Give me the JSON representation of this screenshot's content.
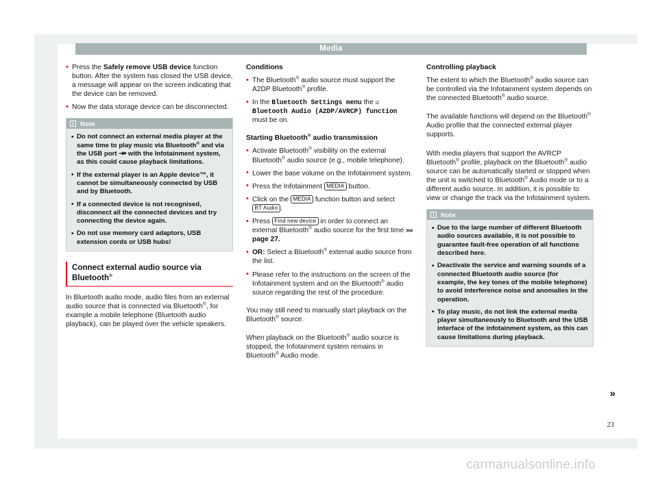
{
  "page": {
    "chapter_header": "Media",
    "page_number": "23",
    "continuation_marker": "»",
    "watermark": "carmanualsonline.info",
    "accent_red": "#e2001a",
    "header_bar_color": "#a8b4b4",
    "note_box_bg": "#e6eaea"
  },
  "left_column": {
    "bullets": [
      {
        "pre": "Press the ",
        "bold": "Safely remove USB device",
        "post": " function button. After the system has closed the USB device, a message will appear on the screen indicating that the device can be removed."
      },
      {
        "pre": "",
        "bold": "",
        "post": "Now the data storage device can be disconnected."
      }
    ],
    "note": {
      "title": "Note",
      "icon": "info-icon",
      "bullets": [
        {
          "part1": "Do not connect an external media player at the same time to play music via Bluetooth",
          "sup1": "®",
          "part2": " and via the USB port ",
          "usb_glyph": "⇥•",
          "part3": " with the Infotainment system, as this could cause playback limitations."
        },
        {
          "text": "If the external player is an Apple device™, it cannot be simultaneously connected by USB and by Bluetooth."
        },
        {
          "text": "If a connected device is not recognised, disconnect all the connected devices and try connecting the device again."
        },
        {
          "text": "Do not use memory card adaptors, USB extension cords or USB hubs!"
        }
      ]
    },
    "section_heading": {
      "text": "Connect external audio source via Bluetooth",
      "sup": "®"
    },
    "paragraph": {
      "p1": "In Bluetooth audio mode, audio files from an external audio source that is connected via Bluetooth",
      "sup1": "®",
      "p2": ", for example a mobile telephone (Bluetooth audio playback), can be played over the vehicle speakers."
    }
  },
  "middle_column": {
    "heading_conditions": "Conditions",
    "conditions": [
      {
        "p1": "The Bluetooth",
        "sup1": "®",
        "p2": " audio source must support the A2DP Bluetooth",
        "sup2": "®",
        "p3": " profile."
      }
    ],
    "condition_menu": {
      "pre": "In the ",
      "menu": "Bluetooth Settings menu",
      "mid": " the ",
      "checkbox": "☑",
      "function_name": "Bluetooth Audio (A2DP/AVRCP) function",
      "post": " must be on."
    },
    "heading_starting": {
      "text": "Starting Bluetooth",
      "sup": "®",
      "text2": " audio transmission"
    },
    "steps": [
      {
        "p1": "Activate Bluetooth",
        "sup1": "®",
        "p2": " visibility on the external Bluetooth",
        "sup2": "®",
        "p3": " audio source (e.g., mobile telephone)."
      },
      {
        "text": "Lower the base volume on the Infotainment system."
      }
    ],
    "step_media_button": {
      "pre": "Press the Infotainment ",
      "chip": "MEDIA",
      "post": " button."
    },
    "step_media_select": {
      "pre": "Click on the ",
      "chip": "MEDIA",
      "mid": " function button and select ",
      "chip2": "BT Audio",
      "post": "."
    },
    "step_find_device": {
      "pre": "Press ",
      "chip": "Find new device",
      "mid": " in order to connect an external Bluetooth",
      "sup": "®",
      "post": " audio source for the first time ",
      "arrow": "»»",
      "ref": " page 27."
    },
    "step_or": {
      "bold": "OR:",
      "p1": " Select a Bluetooth",
      "sup": "®",
      "p2": " external audio source from the list."
    },
    "step_refer": {
      "p1": "Please refer to the instructions on the screen of the Infotainment system and on the Bluetooth",
      "sup": "®",
      "p2": " audio source regarding the rest of the procedure."
    },
    "paragraphs": [
      {
        "p1": "You may still need to manually start playback on the Bluetooth",
        "sup": "®",
        "p2": " source."
      },
      {
        "p1": "When playback on the Bluetooth",
        "sup": "®",
        "p2": " audio source is stopped, the Infotainment system remains in Bluetooth",
        "sup2": "®",
        "p3": " Audio mode."
      }
    ]
  },
  "right_column": {
    "heading": "Controlling playback",
    "paragraphs": [
      {
        "p1": "The extent to which the Bluetooth",
        "sup1": "®",
        "p2": " audio source can be controlled via the Infotainment system depends on the connected Bluetooth",
        "sup2": "®",
        "p3": " audio source."
      },
      {
        "p1": "The available functions will depend on the Bluetooth",
        "sup1": "®",
        "p2": " Audio profile that the connected external player supports."
      },
      {
        "p1": "With media players that support the AVRCP Bluetooth",
        "sup1": "®",
        "p2": " profile, playback on the Bluetooth",
        "sup2": "®",
        "p3": " audio source can be automatically started or stopped when the unit is switched to Bluetooth",
        "sup3": "®",
        "p4": " Audio mode or to a different audio source. In addition, it is possible to view or change the track via the Infotainment system."
      }
    ],
    "note": {
      "title": "Note",
      "icon": "info-icon",
      "bullets": [
        {
          "text": "Due to the large number of different Bluetooth audio sources available, it is not possible to guarantee fault-free operation of all functions described here."
        },
        {
          "text": "Deactivate the service and warning sounds of a connected Bluetooth audio source (for example, the key tones of the mobile telephone) to avoid interference noise and anomalies in the operation."
        },
        {
          "text": "To play music, do not link the external media player simultaneously to Bluetooth and the USB interface of the infotainment system, as this can cause limitations during playback."
        }
      ]
    }
  }
}
